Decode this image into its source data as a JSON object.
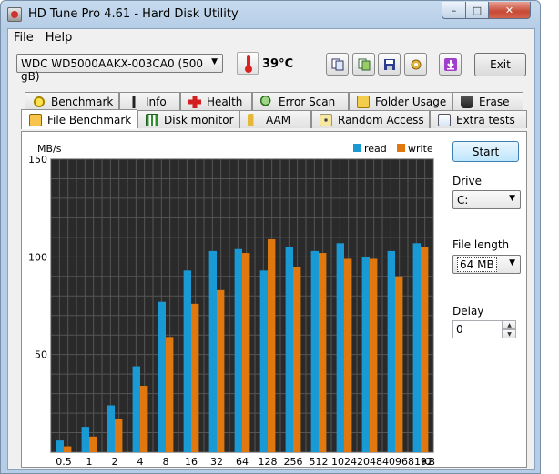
{
  "window": {
    "title": "HD Tune Pro 4.61 - Hard Disk Utility",
    "min_label": "–",
    "max_label": "□",
    "close_label": "✕"
  },
  "menu": {
    "file": "File",
    "help": "Help"
  },
  "toolbar": {
    "drive": "WDC WD5000AAKX-003CA0   (500 gB)",
    "temperature": "39°C",
    "exit_label": "Exit",
    "icons": [
      "copy-info-icon",
      "copy-screenshot-icon",
      "save-icon",
      "options-icon",
      "download-icon"
    ]
  },
  "tabs_row1": [
    {
      "label": "Benchmark",
      "icon": "benchmark-icon"
    },
    {
      "label": "Info",
      "icon": "info-icon"
    },
    {
      "label": "Health",
      "icon": "health-icon"
    },
    {
      "label": "Error Scan",
      "icon": "error-scan-icon"
    },
    {
      "label": "Folder Usage",
      "icon": "folder-icon"
    },
    {
      "label": "Erase",
      "icon": "erase-icon"
    }
  ],
  "tabs_row2": [
    {
      "label": "File Benchmark",
      "icon": "file-benchmark-icon"
    },
    {
      "label": "Disk monitor",
      "icon": "disk-monitor-icon"
    },
    {
      "label": "AAM",
      "icon": "speaker-icon"
    },
    {
      "label": "Random Access",
      "icon": "random-access-icon"
    },
    {
      "label": "Extra tests",
      "icon": "extra-tests-icon"
    }
  ],
  "controls": {
    "start_label": "Start",
    "drive_label": "Drive",
    "drive_value": "C:",
    "file_length_label": "File length",
    "file_length_value": "64 MB",
    "delay_label": "Delay",
    "delay_value": "0"
  },
  "colors": {
    "read": "#1a9ad4",
    "write": "#e0780f",
    "plot_bg": "#2a2a2a",
    "grid": "#555555"
  },
  "chart_data": {
    "type": "bar",
    "ylabel": "MB/s",
    "xunit": "KB",
    "ylim": [
      0,
      150
    ],
    "yticks": [
      50,
      100,
      150
    ],
    "categories": [
      "0.5",
      "1",
      "2",
      "4",
      "8",
      "16",
      "32",
      "64",
      "128",
      "256",
      "512",
      "1024",
      "2048",
      "4096",
      "8192"
    ],
    "series": [
      {
        "name": "read",
        "values": [
          6,
          13,
          24,
          44,
          77,
          93,
          103,
          104,
          93,
          105,
          103,
          107,
          100,
          103,
          107
        ]
      },
      {
        "name": "write",
        "values": [
          3,
          8,
          17,
          34,
          59,
          76,
          83,
          102,
          109,
          95,
          102,
          99,
          99,
          90,
          105
        ]
      }
    ],
    "legend_position": "top-right",
    "grid": true
  }
}
